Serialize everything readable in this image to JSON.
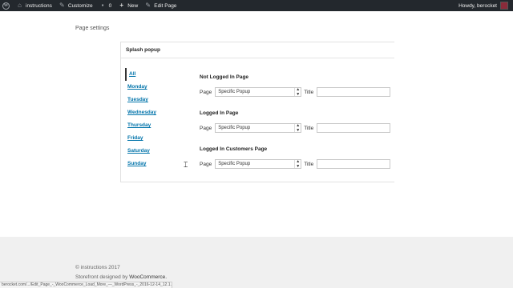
{
  "adminbar": {
    "site_name": "instructions",
    "customize": "Customize",
    "comments_count": "0",
    "new_label": "New",
    "edit_page": "Edit Page",
    "howdy": "Howdy, berocket"
  },
  "page_settings_label": "Page settings",
  "panel": {
    "title": "Splash popup",
    "days": [
      "All",
      "Monday",
      "Tuesday",
      "Wednesday",
      "Thursday",
      "Friday",
      "Saturday",
      "Sunday"
    ],
    "sections": [
      {
        "title": "Not Logged In Page",
        "page_label": "Page",
        "page_value": "Specific Popup",
        "title_label": "Title",
        "title_value": ""
      },
      {
        "title": "Logged In Page",
        "page_label": "Page",
        "page_value": "Specific Popup",
        "title_label": "Title",
        "title_value": ""
      },
      {
        "title": "Logged In Customers Page",
        "page_label": "Page",
        "page_value": "Specific Popup",
        "title_label": "Title",
        "title_value": ""
      }
    ]
  },
  "footer": {
    "copyright": "© instructions 2017",
    "designed_prefix": "Storefront designed by",
    "designed_link": "WooCommerce."
  },
  "statusbar": "berocket.com/.../Edit_Page_-_WooCommerce_Load_More_—_WordPress_-_2016-12-14_12.1..."
}
